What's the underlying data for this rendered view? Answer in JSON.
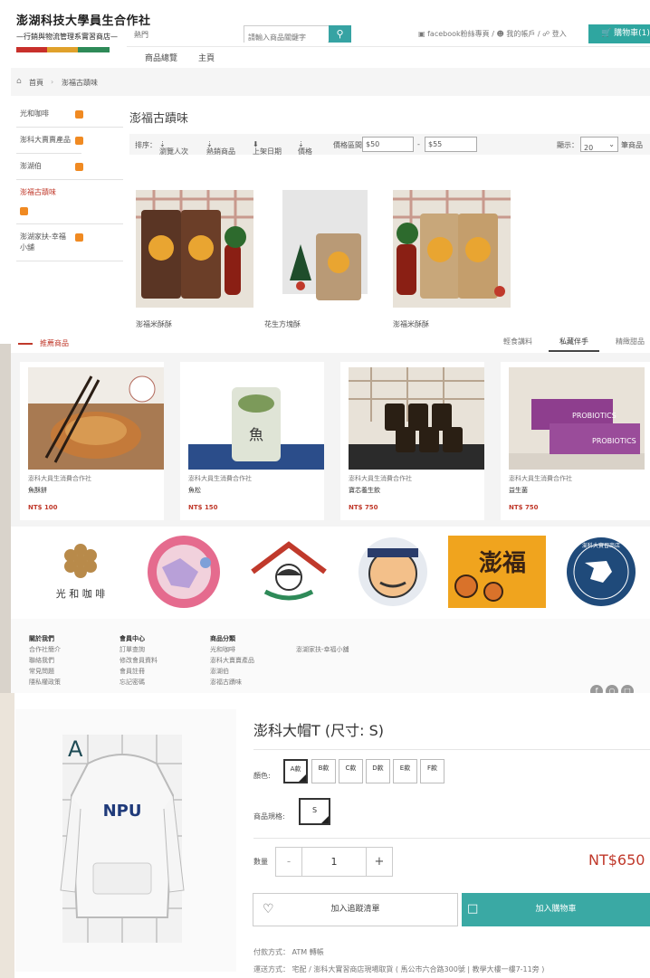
{
  "header": {
    "logo_line1": "澎湖科技大學員生合作社",
    "logo_line2": "—行銷與物流管理系實習商店—",
    "hot_label": "熱門",
    "search_placeholder": "請輸入商品關鍵字",
    "facebook_link": "facebook粉絲專頁",
    "account_link": "我的帳戶",
    "login_link": "登入",
    "cart_label": "購物車(1)",
    "nav": [
      "商品總覽",
      "主頁"
    ]
  },
  "breadcrumb": {
    "home": "首頁",
    "current": "澎福古蹟味"
  },
  "sidebar": {
    "items": [
      {
        "label": "光和咖啡"
      },
      {
        "label": "澎科大賣賣產品"
      },
      {
        "label": "澎湖伯"
      },
      {
        "label": "澎福古蹟味"
      },
      {
        "label": "澎湖家扶-幸福小舖"
      }
    ]
  },
  "category": {
    "title": "澎福古蹟味",
    "sort_label": "排序：",
    "sort_options": [
      "瀏覽人次",
      "熱銷商品",
      "上架日期",
      "價格"
    ],
    "price_range_label": "價格區間",
    "price_min": "$50",
    "price_max": "$55",
    "show_label": "顯示：",
    "per_page": "20",
    "per_page_suffix": "筆商品"
  },
  "products": [
    {
      "name": "澎福米酥酥"
    },
    {
      "name": "花生方塊酥"
    },
    {
      "name": "澎福米酥酥"
    }
  ],
  "recommend": {
    "title": "推薦商品",
    "tabs": [
      "輕食講料",
      "私藏伴手",
      "精緻甜品"
    ],
    "items": [
      {
        "shop": "澎科大員生消費合作社",
        "name": "魚酥餅",
        "price": "NT$ 100"
      },
      {
        "shop": "澎科大員生消費合作社",
        "name": "魚松",
        "price": "NT$ 150"
      },
      {
        "shop": "澎科大員生消費合作社",
        "name": "寶芯養生飲",
        "price": "NT$ 750"
      },
      {
        "shop": "澎科大員生消費合作社",
        "name": "益生菌",
        "price": "NT$ 750"
      }
    ]
  },
  "partners": [
    {
      "name": "光和咖啡",
      "text": "光 和 咖 啡"
    },
    {
      "name": "澎湖縣婦女福利服務中心",
      "text": ""
    },
    {
      "name": "家扶",
      "text": ""
    },
    {
      "name": "澎湖伯",
      "text": ""
    },
    {
      "name": "澎福",
      "text": "澎福"
    },
    {
      "name": "澎科大實習商店",
      "text": "澎科大實習商店"
    }
  ],
  "footer": {
    "columns": [
      {
        "heading": "關於我們",
        "links": [
          "合作社簡介",
          "聯絡我們",
          "常見問題",
          "隱私權政策"
        ]
      },
      {
        "heading": "會員中心",
        "links": [
          "訂單查詢",
          "修改會員資料",
          "會員註冊",
          "忘記密碼"
        ]
      },
      {
        "heading": "商品分類",
        "links": [
          "光和咖啡",
          "澎科大賣賣產品",
          "澎湖伯",
          "澎福古蹟味"
        ]
      },
      {
        "heading": "",
        "links": [
          "澎湖家扶-幸福小舖"
        ]
      }
    ]
  },
  "detail": {
    "title": "澎科大帽T (尺寸: S)",
    "color_label": "顏色:",
    "colors": [
      "A款",
      "B款",
      "C款",
      "D款",
      "E款",
      "F款"
    ],
    "spec_label": "商品規格:",
    "spec": "S",
    "qty_label": "數量",
    "qty": "1",
    "minus": "-",
    "plus": "+",
    "price": "NT$650",
    "wishlist": "加入追蹤清單",
    "add_cart": "加入購物車",
    "payment": "付款方式： ATM 轉帳",
    "shipping": "運送方式： 宅配 / 澎科大實習商店現場取貨 ( 馬公市六合路300號 | 教學大樓一樓7-11旁 )",
    "image_letter": "A"
  },
  "colors": {
    "accent": "#2fa6a0",
    "price": "#c0392b",
    "rss": "#f08a22"
  }
}
